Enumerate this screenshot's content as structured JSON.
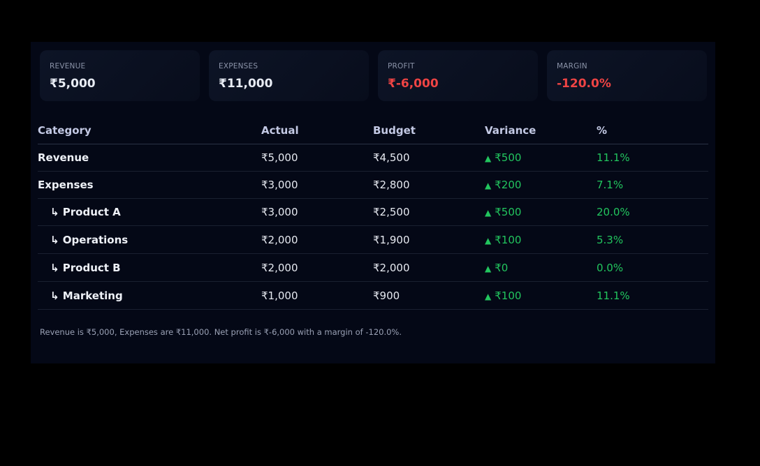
{
  "kpis": [
    {
      "label": "REVENUE",
      "value": "₹5,000"
    },
    {
      "label": "EXPENSES",
      "value": "₹11,000"
    },
    {
      "label": "PROFIT",
      "value": "₹-6,000"
    },
    {
      "label": "MARGIN",
      "value": "-120.0%"
    }
  ],
  "colors": {
    "negative": "#ef4444",
    "positive": "#22c55e",
    "background": "#040816"
  },
  "table": {
    "headers": [
      "Category",
      "Actual",
      "Budget",
      "Variance",
      "%"
    ],
    "rows": [
      {
        "category": "Revenue",
        "actual": "₹5,000",
        "budget": "₹4,500",
        "variance": "₹500",
        "pct": "11.1%"
      },
      {
        "category": "Expenses",
        "actual": "₹3,000",
        "budget": "₹2,800",
        "variance": "₹200",
        "pct": "7.1%"
      },
      {
        "category": "↳ Product A",
        "actual": "₹3,000",
        "budget": "₹2,500",
        "variance": "₹500",
        "pct": "20.0%"
      },
      {
        "category": "↳ Operations",
        "actual": "₹2,000",
        "budget": "₹1,900",
        "variance": "₹100",
        "pct": "5.3%"
      },
      {
        "category": "↳ Product B",
        "actual": "₹2,000",
        "budget": "₹2,000",
        "variance": "₹0",
        "pct": "0.0%"
      },
      {
        "category": "↳ Marketing",
        "actual": "₹1,000",
        "budget": "₹900",
        "variance": "₹100",
        "pct": "11.1%"
      }
    ],
    "variance_icon": "triangle-up-icon",
    "variance_glyph": "▲"
  },
  "summary": "Revenue is ₹5,000, Expenses are ₹11,000. Net profit is ₹-6,000 with a margin of -120.0%."
}
